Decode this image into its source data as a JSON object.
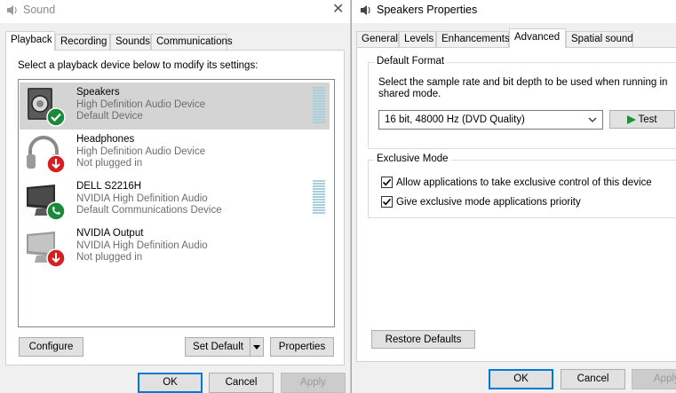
{
  "sound": {
    "title": "Sound",
    "tabs": [
      "Playback",
      "Recording",
      "Sounds",
      "Communications"
    ],
    "instruction": "Select a playback device below to modify its settings:",
    "devices": [
      {
        "name": "Speakers",
        "desc": "High Definition Audio Device",
        "status": "Default Device",
        "badge": "check"
      },
      {
        "name": "Headphones",
        "desc": "High Definition Audio Device",
        "status": "Not plugged in",
        "badge": "down-arrow"
      },
      {
        "name": "DELL S2216H",
        "desc": "NVIDIA High Definition Audio",
        "status": "Default Communications Device",
        "badge": "phone"
      },
      {
        "name": "NVIDIA Output",
        "desc": "NVIDIA High Definition Audio",
        "status": "Not plugged in",
        "badge": "down-arrow"
      }
    ],
    "configure_label": "Configure",
    "set_default_label": "Set Default",
    "properties_label": "Properties",
    "ok_label": "OK",
    "cancel_label": "Cancel",
    "apply_label": "Apply"
  },
  "props": {
    "title": "Speakers Properties",
    "tabs": [
      "General",
      "Levels",
      "Enhancements",
      "Advanced",
      "Spatial sound"
    ],
    "default_format": {
      "heading": "Default Format",
      "description": "Select the sample rate and bit depth to be used when running in shared mode.",
      "selected": "16 bit, 48000 Hz (DVD Quality)",
      "test_label": "Test"
    },
    "exclusive": {
      "heading": "Exclusive Mode",
      "allow_label": "Allow applications to take exclusive control of this device",
      "allow_checked": true,
      "priority_label": "Give exclusive mode applications priority",
      "priority_checked": true
    },
    "restore_label": "Restore Defaults",
    "ok_label": "OK",
    "cancel_label": "Cancel",
    "apply_label": "Apply"
  },
  "colors": {
    "accent": "#0078d7",
    "check_badge": "#1a8a3a",
    "unplugged_badge": "#d42020",
    "play_green": "#1f8f3a"
  }
}
